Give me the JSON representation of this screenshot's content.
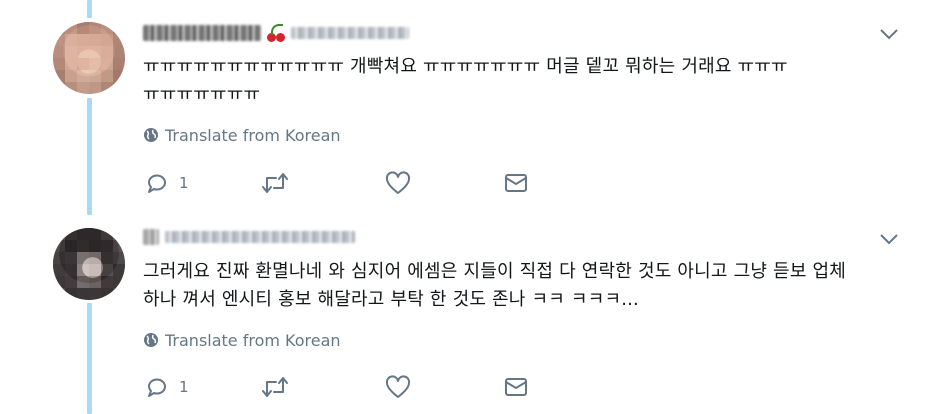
{
  "tweets": [
    {
      "text": "ㅠㅠㅠㅠㅠㅠㅠㅠㅠㅠㅠㅠ 개빡쳐요 ㅠㅠㅠㅠㅠㅠㅠ 머글 뎉꼬 뭐하는 거래요 ㅠㅠㅠ ㅠㅠㅠㅠㅠㅠㅠ",
      "translate_label": "Translate from Korean",
      "reply_count": "1"
    },
    {
      "text": "그러게요 진짜 환멸나네 와 심지어 에셈은 지들이 직접 다 연락한 것도 아니고 그냥 듣보 업체 하나 껴서 엔시티 홍보 해달라고 부탁 한 것도 존나 ㅋㅋ  ㅋㅋㅋ...",
      "translate_label": "Translate from Korean",
      "reply_count": "1"
    }
  ],
  "colors": {
    "thread_line": "#a9d9f3",
    "text": "#14171a",
    "muted": "#657786"
  },
  "icons": [
    "globe-icon",
    "reply-icon",
    "retweet-icon",
    "like-icon",
    "message-icon",
    "chevron-down-icon",
    "cherry-icon"
  ]
}
